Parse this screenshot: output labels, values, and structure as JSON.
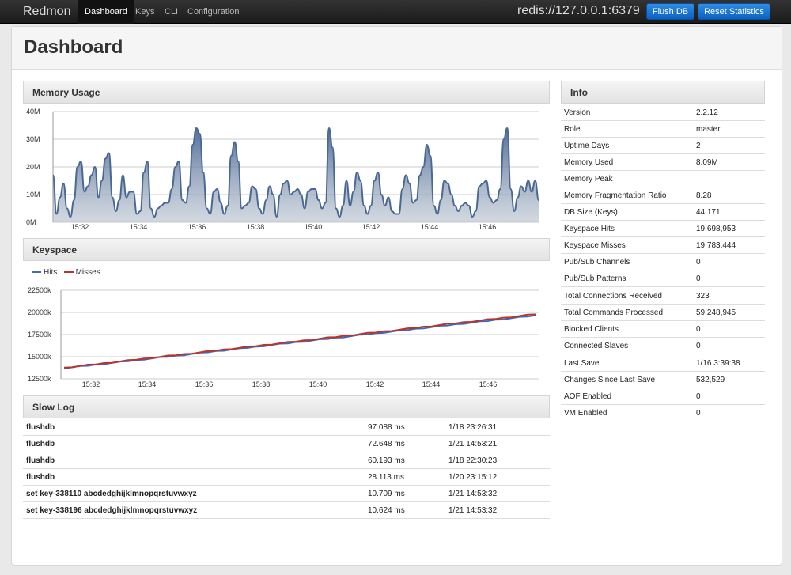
{
  "navbar": {
    "brand": "Redmon",
    "items": [
      {
        "label": "Dashboard",
        "active": true
      },
      {
        "label": "Keys"
      },
      {
        "label": "CLI"
      },
      {
        "label": "Configuration"
      }
    ],
    "server": "redis://127.0.0.1:6379",
    "flush_label": "Flush DB",
    "reset_label": "Reset Statistics",
    "accent": "#1a76d2"
  },
  "page": {
    "title": "Dashboard"
  },
  "memory": {
    "title": "Memory Usage",
    "chart_data": {
      "type": "area",
      "y_ticks": [
        "40M",
        "30M",
        "20M",
        "10M",
        "0M"
      ],
      "x_ticks": [
        "15:32",
        "15:34",
        "15:36",
        "15:38",
        "15:40",
        "15:42",
        "15:44",
        "15:46"
      ],
      "ylim": [
        0,
        40
      ],
      "unit": "M",
      "color": "#4a6894",
      "values": [
        17,
        3,
        9,
        14,
        5,
        2,
        8,
        20,
        22,
        11,
        13,
        17,
        20,
        9,
        15,
        23,
        25,
        9,
        4,
        8,
        17,
        9,
        11,
        11,
        3,
        4,
        18,
        22,
        5,
        2,
        5,
        6,
        7,
        7,
        12,
        20,
        22,
        8,
        7,
        13,
        28,
        34,
        32,
        18,
        5,
        3,
        11,
        12,
        7,
        3,
        6,
        24,
        29,
        22,
        5,
        6,
        7,
        13,
        12,
        5,
        3,
        8,
        13,
        10,
        2,
        10,
        14,
        15,
        10,
        11,
        12,
        10,
        5,
        11,
        12,
        12,
        8,
        5,
        7,
        34,
        27,
        5,
        2,
        6,
        15,
        6,
        11,
        18,
        15,
        6,
        3,
        6,
        15,
        18,
        10,
        6,
        9,
        4,
        3,
        3,
        12,
        17,
        14,
        7,
        8,
        17,
        20,
        28,
        24,
        6,
        3,
        8,
        15,
        14,
        10,
        6,
        4,
        6,
        7,
        6,
        2,
        4,
        13,
        14,
        15,
        9,
        7,
        8,
        12,
        30,
        34,
        12,
        4,
        9,
        13,
        11,
        15,
        11,
        15,
        8
      ]
    }
  },
  "keyspace": {
    "title": "Keyspace",
    "chart_data": {
      "type": "line",
      "y_ticks": [
        "22500k",
        "20000k",
        "17500k",
        "15000k",
        "12500k"
      ],
      "x_ticks": [
        "15:32",
        "15:34",
        "15:36",
        "15:38",
        "15:40",
        "15:42",
        "15:44",
        "15:46"
      ],
      "ylim": [
        12500,
        22500
      ],
      "series": [
        {
          "name": "Hits",
          "color": "#3d6bb5",
          "start": 13700,
          "end": 19650
        },
        {
          "name": "Misses",
          "color": "#b8352f",
          "start": 13750,
          "end": 19800
        }
      ]
    }
  },
  "slowlog": {
    "title": "Slow Log",
    "rows": [
      {
        "cmd": "flushdb",
        "dur": "97.088 ms",
        "time": "1/18 23:26:31"
      },
      {
        "cmd": "flushdb",
        "dur": "72.648 ms",
        "time": "1/21 14:53:21"
      },
      {
        "cmd": "flushdb",
        "dur": "60.193 ms",
        "time": "1/18 22:30:23"
      },
      {
        "cmd": "flushdb",
        "dur": "28.113 ms",
        "time": "1/20 23:15:12"
      },
      {
        "cmd": "set key-338110 abcdedghijklmnopqrstuvwxyz",
        "dur": "10.709 ms",
        "time": "1/21 14:53:32"
      },
      {
        "cmd": "set key-338196 abcdedghijklmnopqrstuvwxyz",
        "dur": "10.624 ms",
        "time": "1/21 14:53:32"
      }
    ]
  },
  "info": {
    "title": "Info",
    "rows": [
      {
        "k": "Version",
        "v": "2.2.12"
      },
      {
        "k": "Role",
        "v": "master"
      },
      {
        "k": "Uptime Days",
        "v": "2"
      },
      {
        "k": "Memory Used",
        "v": "8.09M"
      },
      {
        "k": "Memory Peak",
        "v": ""
      },
      {
        "k": "Memory Fragmentation Ratio",
        "v": "8.28"
      },
      {
        "k": "DB Size (Keys)",
        "v": "44,171"
      },
      {
        "k": "Keyspace Hits",
        "v": "19,698,953"
      },
      {
        "k": "Keyspace Misses",
        "v": "19,783,444"
      },
      {
        "k": "Pub/Sub Channels",
        "v": "0"
      },
      {
        "k": "Pub/Sub Patterns",
        "v": "0"
      },
      {
        "k": "Total Connections Received",
        "v": "323"
      },
      {
        "k": "Total Commands Processed",
        "v": "59,248,945"
      },
      {
        "k": "Blocked Clients",
        "v": "0"
      },
      {
        "k": "Connected Slaves",
        "v": "0"
      },
      {
        "k": "Last Save",
        "v": "1/16 3:39:38"
      },
      {
        "k": "Changes Since Last Save",
        "v": "532,529"
      },
      {
        "k": "AOF Enabled",
        "v": "0"
      },
      {
        "k": "VM Enabled",
        "v": "0"
      }
    ]
  }
}
